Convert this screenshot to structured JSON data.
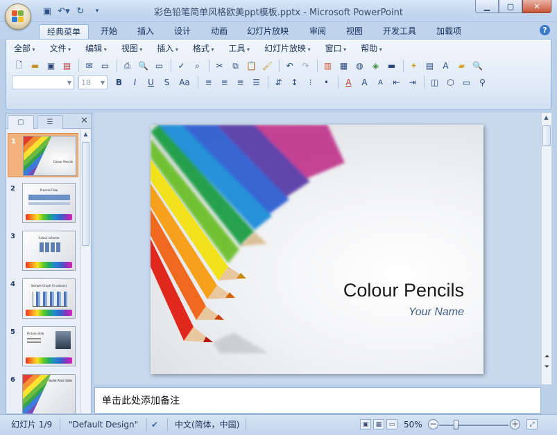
{
  "window": {
    "title": "彩色铅笔简单风格欧美ppt模板.pptx - Microsoft PowerPoint",
    "controls": [
      "minimize-icon",
      "maximize-icon",
      "close-icon"
    ]
  },
  "quick_access": [
    "save-icon",
    "undo-icon",
    "redo-icon",
    "customize-icon"
  ],
  "ribbon": {
    "tabs": [
      "经典菜单",
      "开始",
      "插入",
      "设计",
      "动画",
      "幻灯片放映",
      "审阅",
      "视图",
      "开发工具",
      "加载项"
    ],
    "active_tab": "经典菜单",
    "menus": [
      "全部",
      "文件",
      "编辑",
      "视图",
      "插入",
      "格式",
      "工具",
      "幻灯片放映",
      "窗口",
      "帮助"
    ],
    "font_name": "",
    "font_size": "18"
  },
  "panel": {
    "slides": [
      {
        "num": "1",
        "caption": "Colour Pencils"
      },
      {
        "num": "2",
        "caption": "Process Flow"
      },
      {
        "num": "3",
        "caption": "Colour scheme"
      },
      {
        "num": "4",
        "caption": "Sample Graph (3 colours)"
      },
      {
        "num": "5",
        "caption": "Picture slide"
      },
      {
        "num": "6",
        "caption": "Bullet Point Slide"
      }
    ]
  },
  "slide": {
    "title": "Colour Pencils",
    "subtitle": "Your Name"
  },
  "notes": {
    "placeholder": "单击此处添加备注"
  },
  "status": {
    "slide_indicator": "幻灯片 1/9",
    "theme": "\"Default Design\"",
    "language": "中文(简体，中国)",
    "zoom": "50%"
  },
  "colors": {
    "ribbon_border": "#8db2e3",
    "selected_slide": "#f1b27b",
    "subtitle": "#3e5f86"
  }
}
